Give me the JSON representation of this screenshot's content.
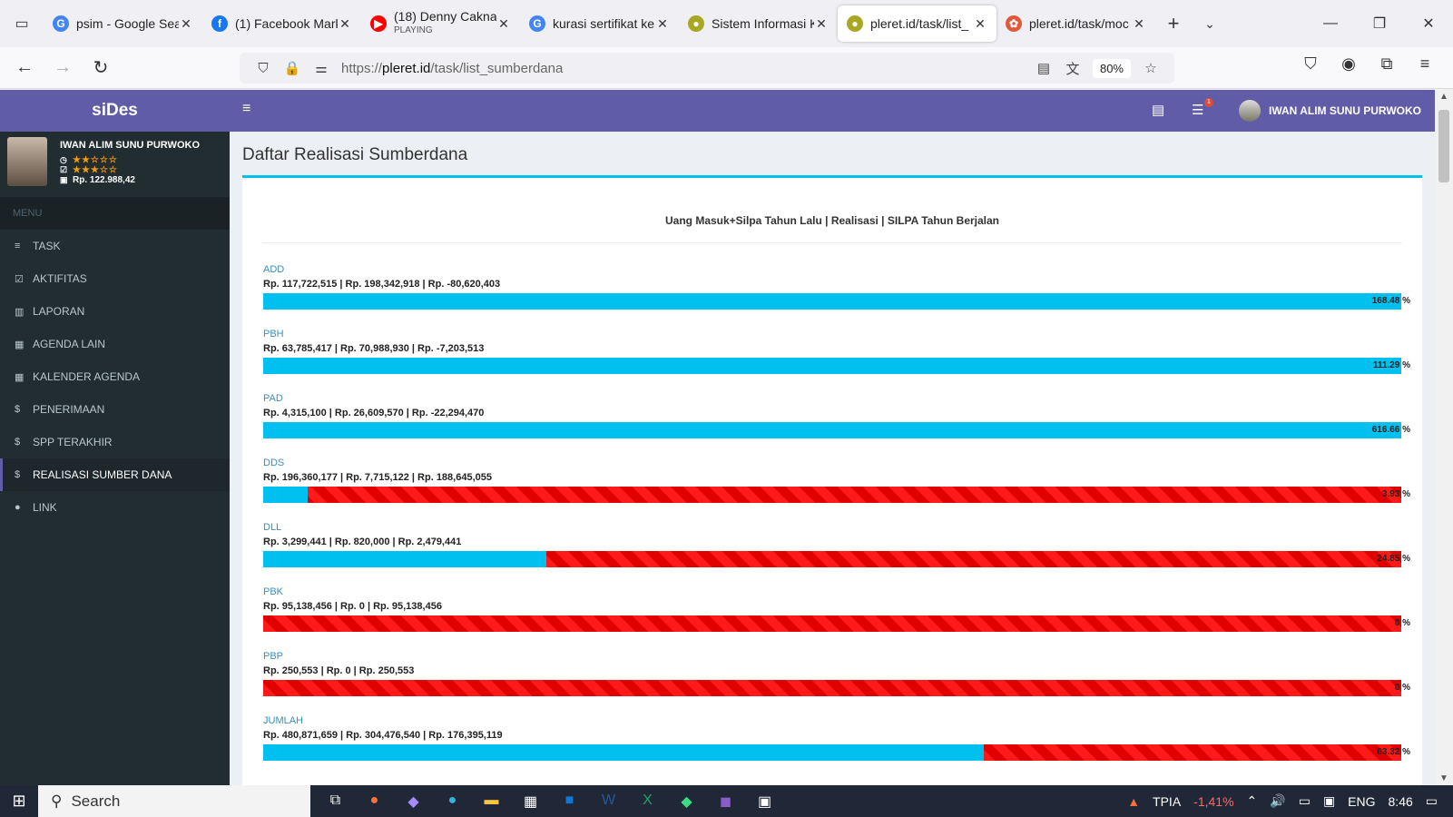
{
  "browser": {
    "tabs": [
      {
        "title": "psim - Google Sea",
        "sub": "",
        "fav": "G",
        "color": "#4285f4"
      },
      {
        "title": "(1) Facebook Mark",
        "sub": "",
        "fav": "f",
        "color": "#1877f2"
      },
      {
        "title": "(18) Denny Cakna",
        "sub": "PLAYING",
        "fav": "▶",
        "color": "#ff0000"
      },
      {
        "title": "kurasi sertifikat ke",
        "sub": "",
        "fav": "G",
        "color": "#4285f4"
      },
      {
        "title": "Sistem Informasi K",
        "sub": "",
        "fav": "●",
        "color": "#a8a825"
      },
      {
        "title": "pleret.id/task/list_",
        "sub": "",
        "fav": "●",
        "color": "#a8a825"
      },
      {
        "title": "pleret.id/task/moc",
        "sub": "",
        "fav": "✿",
        "color": "#e2583e"
      }
    ],
    "url_prefix": "https://",
    "url_domain": "pleret.id",
    "url_path": "/task/list_sumberdana",
    "zoom": "80%"
  },
  "app": {
    "brand": "siDes",
    "user_name": "IWAN ALIM SUNU PURWOKO",
    "stars1": "★★☆☆☆",
    "stars2": "★★★☆☆",
    "balance": "Rp. 122.988,42",
    "menu_header": "MENU",
    "menu": [
      {
        "label": "TASK",
        "icon": "list-icon",
        "glyph": "≡"
      },
      {
        "label": "AKTIFITAS",
        "icon": "check-square-icon",
        "glyph": "☑"
      },
      {
        "label": "LAPORAN",
        "icon": "bar-chart-icon",
        "glyph": "▥"
      },
      {
        "label": "AGENDA LAIN",
        "icon": "calendar-icon",
        "glyph": "▦"
      },
      {
        "label": "KALENDER AGENDA",
        "icon": "calendar-icon",
        "glyph": "▦"
      },
      {
        "label": "PENERIMAAN",
        "icon": "dollar-icon",
        "glyph": "$"
      },
      {
        "label": "SPP TERAKHIR",
        "icon": "dollar-icon",
        "glyph": "$"
      },
      {
        "label": "REALISASI SUMBER DANA",
        "icon": "dollar-icon",
        "glyph": "$"
      },
      {
        "label": "LINK",
        "icon": "globe-icon",
        "glyph": "●"
      }
    ],
    "notif_badge": "1",
    "page_title": "Daftar Realisasi Sumberdana",
    "box_title": "Uang Masuk+Silpa Tahun Lalu | Realisasi | SILPA Tahun Berjalan"
  },
  "items": [
    {
      "name": "ADD",
      "values": "Rp. 117,722,515 | Rp. 198,342,918 | Rp. -80,620,403",
      "pct_label": "168.48 %",
      "pct": 168.48
    },
    {
      "name": "PBH",
      "values": "Rp. 63,785,417 | Rp. 70,988,930 | Rp. -7,203,513",
      "pct_label": "111.29 %",
      "pct": 111.29
    },
    {
      "name": "PAD",
      "values": "Rp. 4,315,100 | Rp. 26,609,570 | Rp. -22,294,470",
      "pct_label": "616.66 %",
      "pct": 616.66
    },
    {
      "name": "DDS",
      "values": "Rp. 196,360,177 | Rp. 7,715,122 | Rp. 188,645,055",
      "pct_label": "3.93 %",
      "pct": 3.93
    },
    {
      "name": "DLL",
      "values": "Rp. 3,299,441 | Rp. 820,000 | Rp. 2,479,441",
      "pct_label": "24.85 %",
      "pct": 24.85
    },
    {
      "name": "PBK",
      "values": "Rp. 95,138,456 | Rp. 0 | Rp. 95,138,456",
      "pct_label": "0 %",
      "pct": 0
    },
    {
      "name": "PBP",
      "values": "Rp. 250,553 | Rp. 0 | Rp. 250,553",
      "pct_label": "0 %",
      "pct": 0
    },
    {
      "name": "JUMLAH",
      "values": "Rp. 480,871,659 | Rp. 304,476,540 | Rp. 176,395,119",
      "pct_label": "63.32 %",
      "pct": 63.32
    }
  ],
  "colors": {
    "fill": "#00c0ef",
    "remaining": "#ff1a1a",
    "accent": "#605ca8"
  },
  "taskbar": {
    "search_placeholder": "Search",
    "ticker": "TPIA",
    "ticker_change": "-1,41%",
    "lang": "ENG",
    "time": "8:46"
  }
}
